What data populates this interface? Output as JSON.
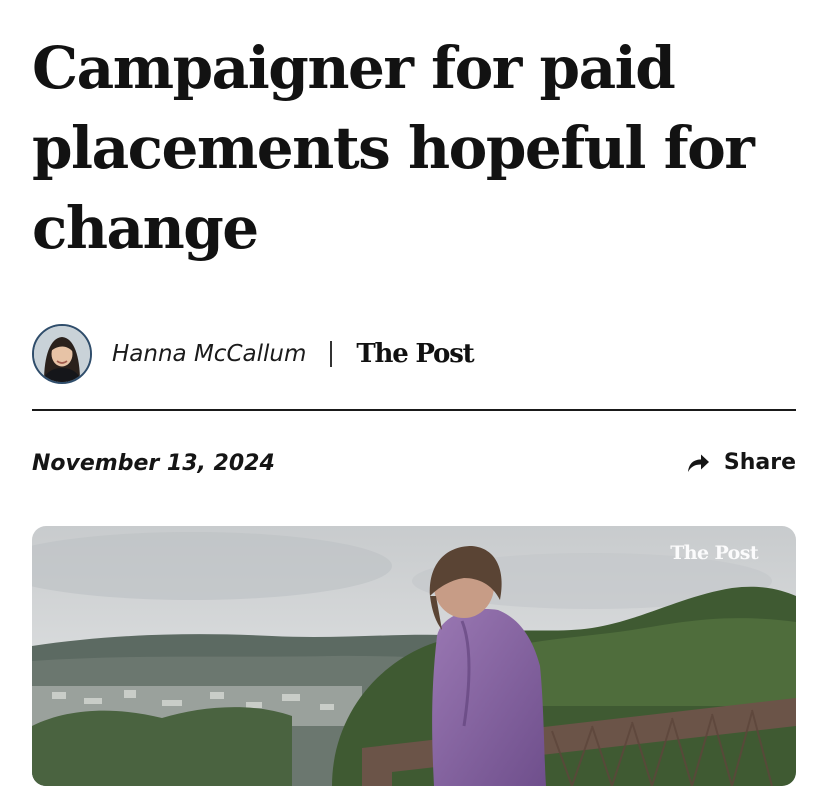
{
  "article": {
    "headline": "Campaigner for paid placements hopeful for change",
    "author": "Hanna McCallum",
    "publication": "The Post",
    "date": "November 13, 2024",
    "share_label": "Share"
  },
  "hero_image": {
    "watermark": "The Post"
  },
  "icons": {
    "share": "share-arrow-icon",
    "avatar": "author-avatar"
  },
  "colors": {
    "text": "#111111",
    "avatar_border": "#2f4d6b",
    "rule": "#1a1a1a"
  }
}
